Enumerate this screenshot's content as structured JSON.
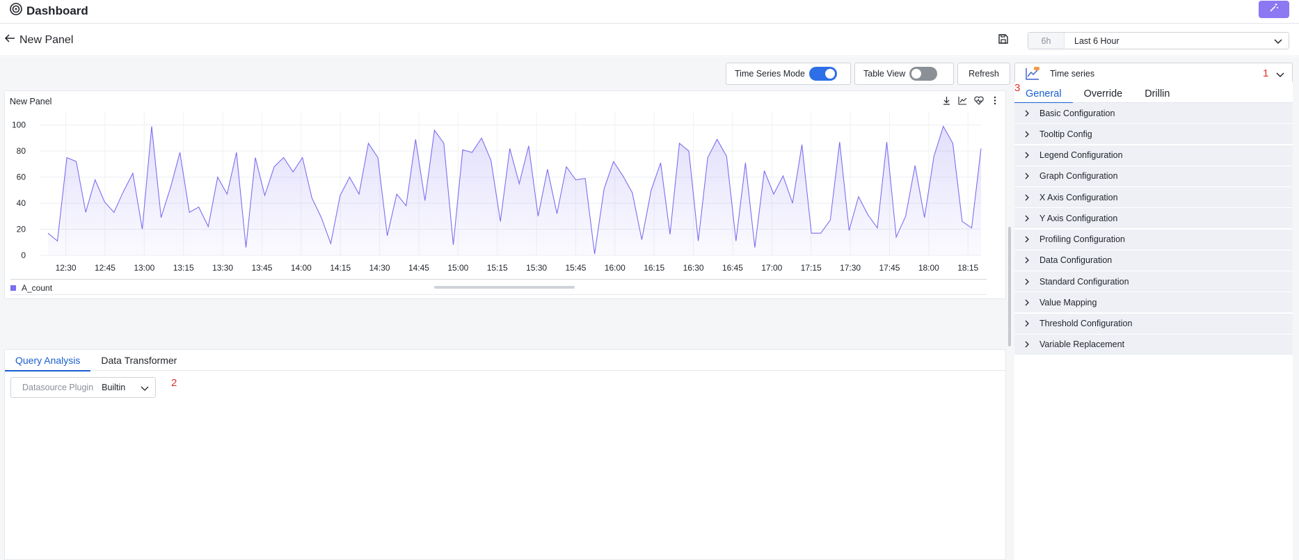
{
  "app": {
    "title": "Dashboard"
  },
  "header": {
    "back_label": "New Panel",
    "time_short": "6h",
    "time_range": "Last 6 Hour"
  },
  "toolbar": {
    "time_series_mode": "Time Series Mode",
    "table_view": "Table View",
    "refresh": "Refresh"
  },
  "panel": {
    "title": "New Panel",
    "legend_label": "A_count",
    "series_color": "#7b6ef0"
  },
  "query": {
    "tabs": [
      "Query Analysis",
      "Data Transformer"
    ],
    "datasource_label": "Datasource Plugin",
    "datasource_value": "Builtin"
  },
  "right": {
    "viz_type": "Time series",
    "tabs": [
      "General",
      "Override",
      "Drillin"
    ],
    "config_items": [
      "Basic Configuration",
      "Tooltip Config",
      "Legend Configuration",
      "Graph Configuration",
      "X Axis Configuration",
      "Y Axis Configuration",
      "Profiling Configuration",
      "Data Configuration",
      "Standard Configuration",
      "Value Mapping",
      "Threshold Configuration",
      "Variable Replacement"
    ]
  },
  "markers": [
    "1",
    "2",
    "3"
  ],
  "chart_data": {
    "type": "area",
    "title": "New Panel",
    "xlabel": "",
    "ylabel": "",
    "ylim": [
      0,
      110
    ],
    "y_ticks": [
      0,
      20,
      40,
      60,
      80,
      100
    ],
    "x_tick_labels": [
      "12:30",
      "12:45",
      "13:00",
      "13:15",
      "13:30",
      "13:45",
      "14:00",
      "14:15",
      "14:30",
      "14:45",
      "15:00",
      "15:15",
      "15:30",
      "15:45",
      "16:00",
      "16:15",
      "16:30",
      "16:45",
      "17:00",
      "17:15",
      "17:30",
      "17:45",
      "18:00",
      "18:15"
    ],
    "x_start": "12:20",
    "x_end": "18:20",
    "series": [
      {
        "name": "A_count",
        "values": [
          17,
          11,
          75,
          72,
          33,
          58,
          41,
          33,
          49,
          63,
          20,
          99,
          29,
          52,
          79,
          33,
          37,
          22,
          60,
          47,
          79,
          6,
          75,
          46,
          68,
          75,
          64,
          75,
          44,
          29,
          9,
          46,
          60,
          47,
          86,
          75,
          15,
          47,
          38,
          89,
          42,
          96,
          86,
          8,
          81,
          79,
          90,
          73,
          26,
          82,
          55,
          84,
          30,
          66,
          32,
          68,
          58,
          59,
          1,
          51,
          72,
          61,
          48,
          12,
          50,
          71,
          16,
          86,
          80,
          11,
          75,
          89,
          76,
          11,
          71,
          6,
          65,
          47,
          61,
          40,
          85,
          17,
          17,
          27,
          87,
          19,
          45,
          31,
          21,
          87,
          14,
          30,
          69,
          29,
          76,
          99,
          86,
          26,
          21,
          82
        ]
      }
    ],
    "grid": true,
    "legend": "bottom-left"
  }
}
